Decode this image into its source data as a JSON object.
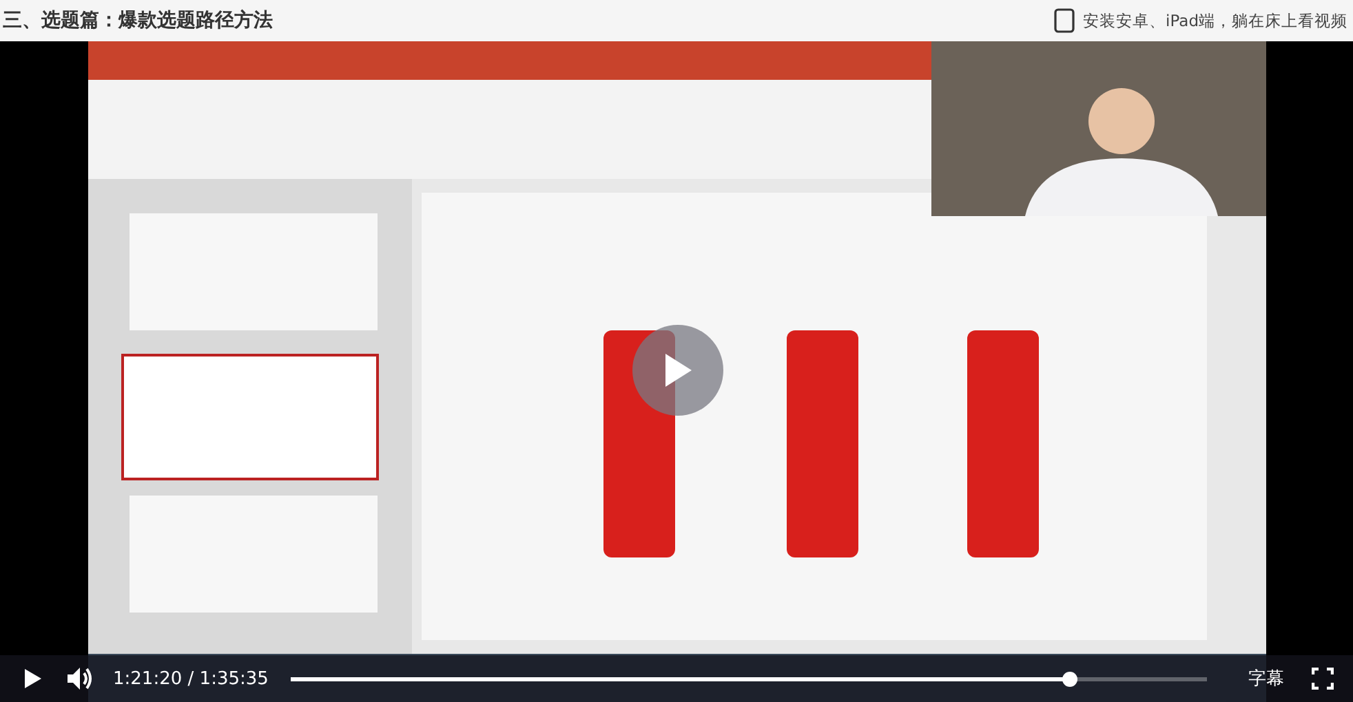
{
  "header": {
    "title": "三、选题篇：爆款选题路径方法",
    "promo": "安装安卓、iPad端，躺在床上看视频"
  },
  "player": {
    "playing": false,
    "current_time": "1:21:20",
    "separator": "/",
    "duration": "1:35:35",
    "level": 0.85,
    "subtitles": "字幕"
  }
}
